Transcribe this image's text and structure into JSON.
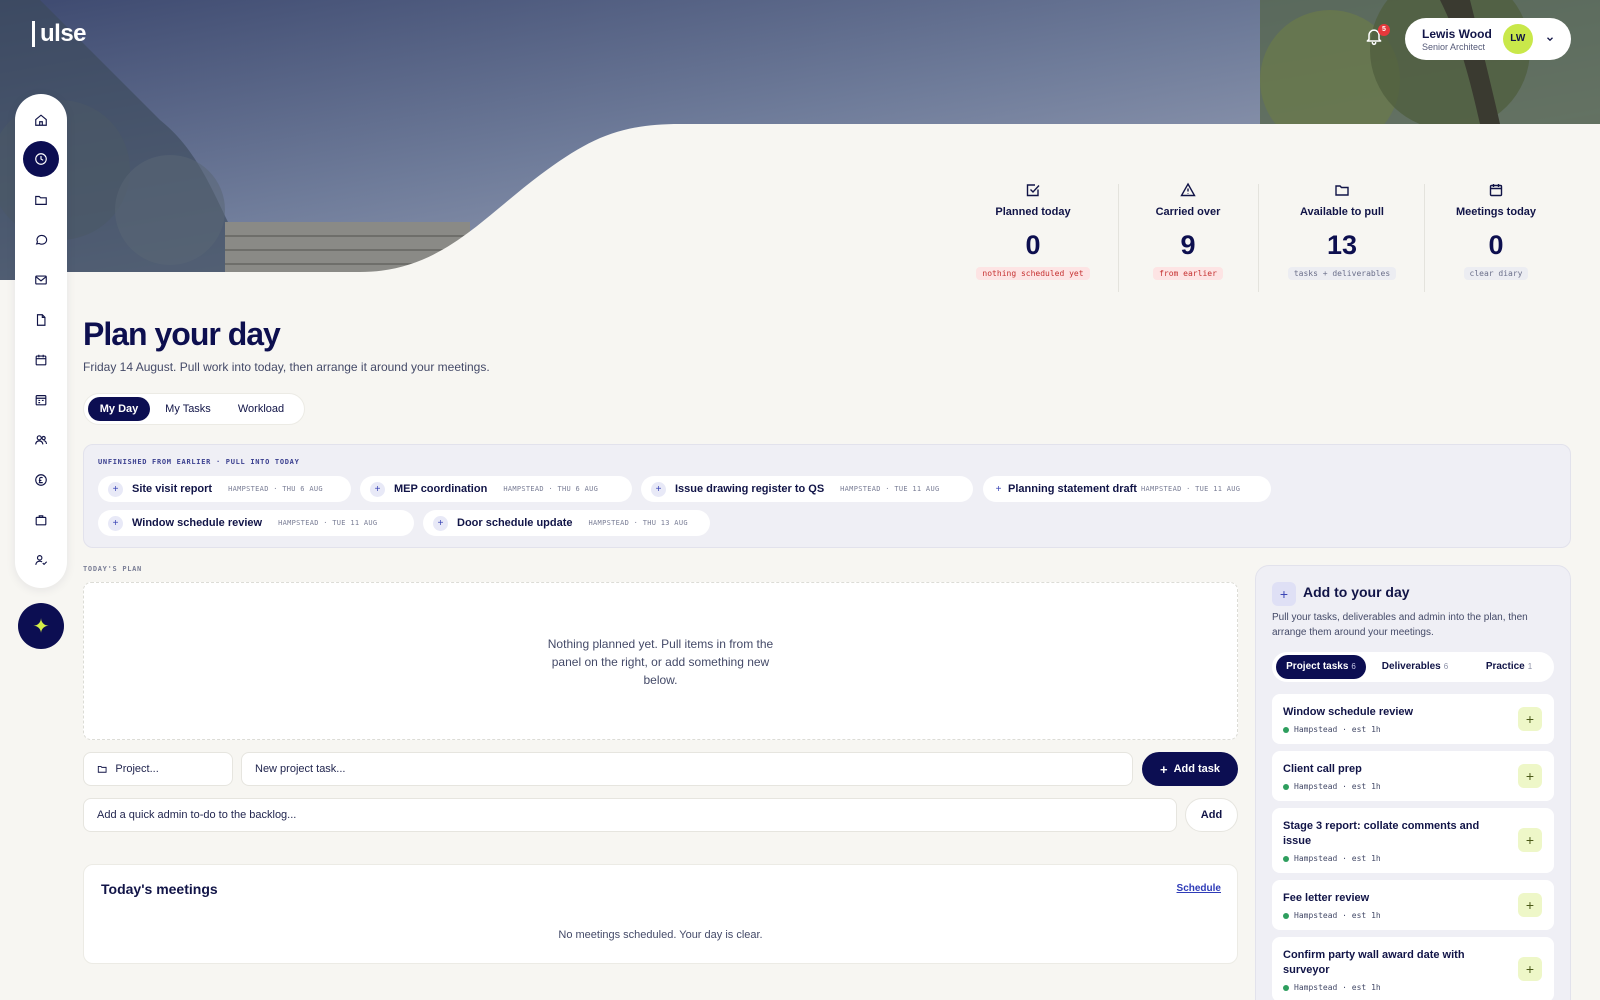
{
  "app": {
    "logo": "ulse"
  },
  "header": {
    "notifications_count": "5",
    "user": {
      "name": "Lewis Wood",
      "role": "Senior Architect",
      "initials": "LW"
    }
  },
  "sidebar": {
    "items": [
      {
        "icon": "home-icon"
      },
      {
        "icon": "clock-icon",
        "active": true
      },
      {
        "icon": "folder-icon"
      },
      {
        "icon": "chat-icon"
      },
      {
        "icon": "mail-icon"
      },
      {
        "icon": "document-icon"
      },
      {
        "icon": "calendar-icon"
      },
      {
        "icon": "schedule-icon"
      },
      {
        "icon": "team-icon"
      },
      {
        "icon": "fees-icon"
      },
      {
        "icon": "briefcase-icon"
      },
      {
        "icon": "user-check-icon"
      }
    ],
    "fab_icon": "sparkle-icon"
  },
  "stats": [
    {
      "label": "Planned today",
      "value": "0",
      "note": "nothing scheduled yet",
      "tone": "red",
      "icon": "check-square-icon"
    },
    {
      "label": "Carried over",
      "value": "9",
      "note": "from earlier",
      "tone": "red",
      "icon": "warning-icon"
    },
    {
      "label": "Available to pull",
      "value": "13",
      "note": "tasks + deliverables",
      "tone": "grey",
      "icon": "folder-icon"
    },
    {
      "label": "Meetings today",
      "value": "0",
      "note": "clear diary",
      "tone": "grey",
      "icon": "calendar-icon"
    }
  ],
  "page": {
    "title": "Plan your day",
    "subtitle": "Friday 14 August. Pull work into today, then arrange it around your meetings."
  },
  "tabs": [
    "My Day",
    "My Tasks",
    "Workload"
  ],
  "unfinished": {
    "eyebrow": "UNFINISHED FROM EARLIER · PULL INTO TODAY",
    "items": [
      {
        "title": "Site visit report",
        "meta": "HAMPSTEAD · THU 6 AUG"
      },
      {
        "title": "MEP coordination",
        "meta": "HAMPSTEAD · THU 6 AUG"
      },
      {
        "title": "Issue drawing register to QS",
        "meta": "HAMPSTEAD · TUE 11 AUG"
      },
      {
        "title": "Planning statement draft",
        "meta": "HAMPSTEAD · TUE 11 AUG"
      },
      {
        "title": "Window schedule review",
        "meta": "HAMPSTEAD · TUE 11 AUG"
      },
      {
        "title": "Door schedule update",
        "meta": "HAMPSTEAD · THU 13 AUG"
      }
    ]
  },
  "plan": {
    "eyebrow": "TODAY'S PLAN",
    "empty": "Nothing planned yet. Pull items in from the panel on the right, or add something new below."
  },
  "form": {
    "project_placeholder": "Project...",
    "task_placeholder": "New project task...",
    "add_task": "Add task",
    "admin_placeholder": "Add a quick admin to-do to the backlog...",
    "add": "Add"
  },
  "meetings": {
    "title": "Today's meetings",
    "link": "Schedule",
    "empty": "No meetings scheduled. Your day is clear."
  },
  "add_panel": {
    "title": "Add to your day",
    "description": "Pull your tasks, deliverables and admin into the plan, then arrange them around your meetings.",
    "tabs": [
      {
        "label": "Project tasks",
        "count": "6"
      },
      {
        "label": "Deliverables",
        "count": "6"
      },
      {
        "label": "Practice",
        "count": "1"
      }
    ],
    "tasks": [
      {
        "title": "Window schedule review",
        "meta": "Hampstead · est 1h"
      },
      {
        "title": "Client call prep",
        "meta": "Hampstead · est 1h"
      },
      {
        "title": "Stage 3 report: collate comments and issue",
        "meta": "Hampstead · est 1h"
      },
      {
        "title": "Fee letter review",
        "meta": "Hampstead · est 1h"
      },
      {
        "title": "Confirm party wall award date with surveyor",
        "meta": "Hampstead · est 1h"
      }
    ]
  },
  "colors": {
    "navy": "#0c0e52",
    "accent": "#c9e84a",
    "danger": "#e5383b"
  }
}
